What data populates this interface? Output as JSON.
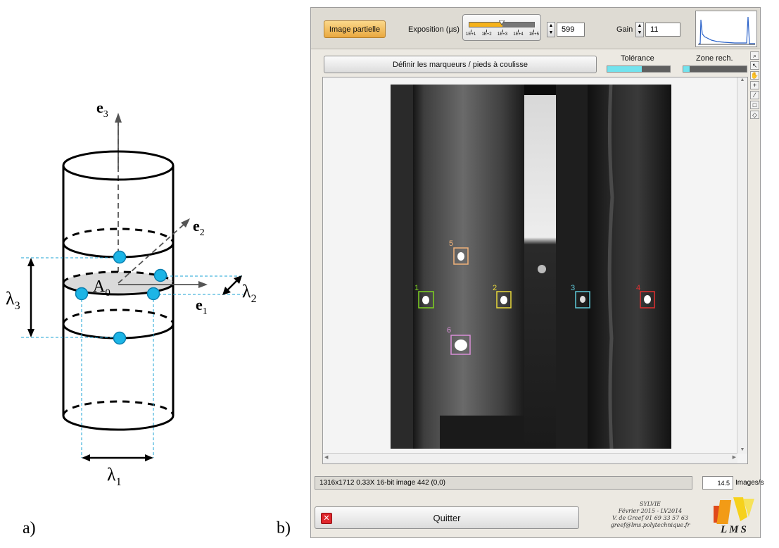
{
  "panel_a": {
    "label": "a)",
    "axes": {
      "e3": "e",
      "e3_sub": "3",
      "e2": "e",
      "e2_sub": "2",
      "e1": "e",
      "e1_sub": "1"
    },
    "point_label": "A",
    "point_sub": "0",
    "lambda1": "λ",
    "lambda1_sub": "1",
    "lambda2": "λ",
    "lambda2_sub": "2",
    "lambda3": "λ",
    "lambda3_sub": "3",
    "marker_color": "#1cb5e6"
  },
  "panel_b": {
    "label": "b)",
    "toolbar": {
      "partial_image_label": "Image partielle",
      "exposure_label": "Exposition (µs)",
      "exposure_ticks": [
        "1E+1",
        "1E+2",
        "1E+3",
        "1E+4",
        "1E+5"
      ],
      "exposure_slider_fraction": 0.5,
      "exposure_value": "599",
      "gain_label": "Gain",
      "gain_value": "11"
    },
    "markers_button_label": "Définir les marqueurs / pieds à coulisse",
    "tolerance": {
      "label": "Tolérance",
      "fraction": 0.55
    },
    "search_zone": {
      "label": "Zone rech.",
      "fraction": 0.1
    },
    "markers": [
      {
        "id": "1",
        "color": "#7ed321"
      },
      {
        "id": "2",
        "color": "#e8d83a"
      },
      {
        "id": "3",
        "color": "#5fc8d8"
      },
      {
        "id": "4",
        "color": "#e03030"
      },
      {
        "id": "5",
        "color": "#f0b27a"
      },
      {
        "id": "6",
        "color": "#d98fd8"
      }
    ],
    "status_text": "1316x1712 0.33X 16-bit image 442    (0,0)",
    "fps_value": "14.5",
    "fps_unit": "Images/s",
    "quit_label": "Quitter",
    "credits": {
      "line1": "SYLVIE",
      "line2": "Février 2015 - LV2014",
      "line3": "V. de Greef    01 69 33 57 63",
      "line4": "greef@lms.polytechnique.fr"
    },
    "logo_text": "LMS"
  }
}
